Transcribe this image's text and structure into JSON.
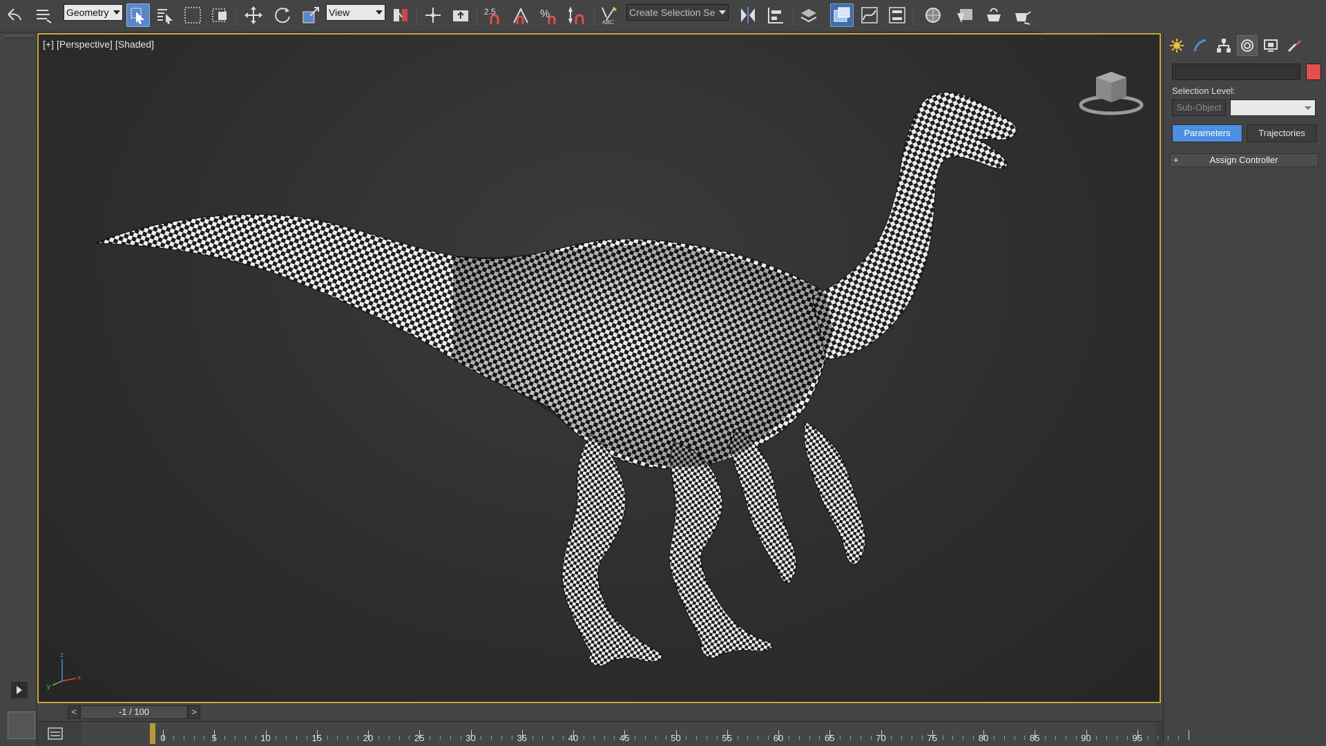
{
  "toolbar": {
    "selection_filter": "Geometry",
    "ref_coord_system": "View",
    "named_selection_placeholder": "Create Selection Se",
    "snap_value": "2.5",
    "icons": [
      "undo-icon",
      "redo-icon",
      "select-object-icon",
      "select-by-name-icon",
      "rectangular-selection-icon",
      "window-crossing-icon",
      "move-icon",
      "rotate-icon",
      "scale-icon",
      "pivot-center-icon",
      "select-manipulate-icon",
      "keyboard-shortcut-icon",
      "snap-toggle-icon",
      "angle-snap-icon",
      "percent-snap-icon",
      "spinner-snap-icon",
      "edit-named-selection-icon",
      "mirror-icon",
      "align-icon",
      "layer-explorer-icon",
      "scene-explorer-icon",
      "curve-editor-icon",
      "schematic-view-icon",
      "material-editor-icon",
      "render-setup-icon",
      "rendered-frame-window-icon",
      "render-production-icon"
    ]
  },
  "viewport": {
    "label_plus": "[+]",
    "label_view": "[Perspective]",
    "label_shading": "[Shaded]",
    "border_color": "#c9a43a",
    "axis_x": "x",
    "axis_y": "y",
    "axis_z": "z"
  },
  "command_panel": {
    "object_color": "#e2504d",
    "selection_level_label": "Selection Level:",
    "sub_object_label": "Sub-Object",
    "parameters_label": "Parameters",
    "trajectories_label": "Trajectories",
    "assign_controller_label": "Assign Controller",
    "rollout_plus": "+",
    "tabs": [
      "create-icon",
      "modify-icon",
      "hierarchy-icon",
      "motion-icon",
      "display-icon",
      "utilities-icon"
    ]
  },
  "time_slider": {
    "prev": "<",
    "next": ">",
    "frame_display": "-1 / 100"
  },
  "trackbar": {
    "tick_labels": [
      "0",
      "5",
      "10",
      "15",
      "20",
      "25",
      "30",
      "35",
      "40",
      "45",
      "50",
      "55",
      "60",
      "65",
      "70",
      "75",
      "80",
      "85",
      "90",
      "95"
    ],
    "current_frame": -1,
    "total_frames": 100
  }
}
